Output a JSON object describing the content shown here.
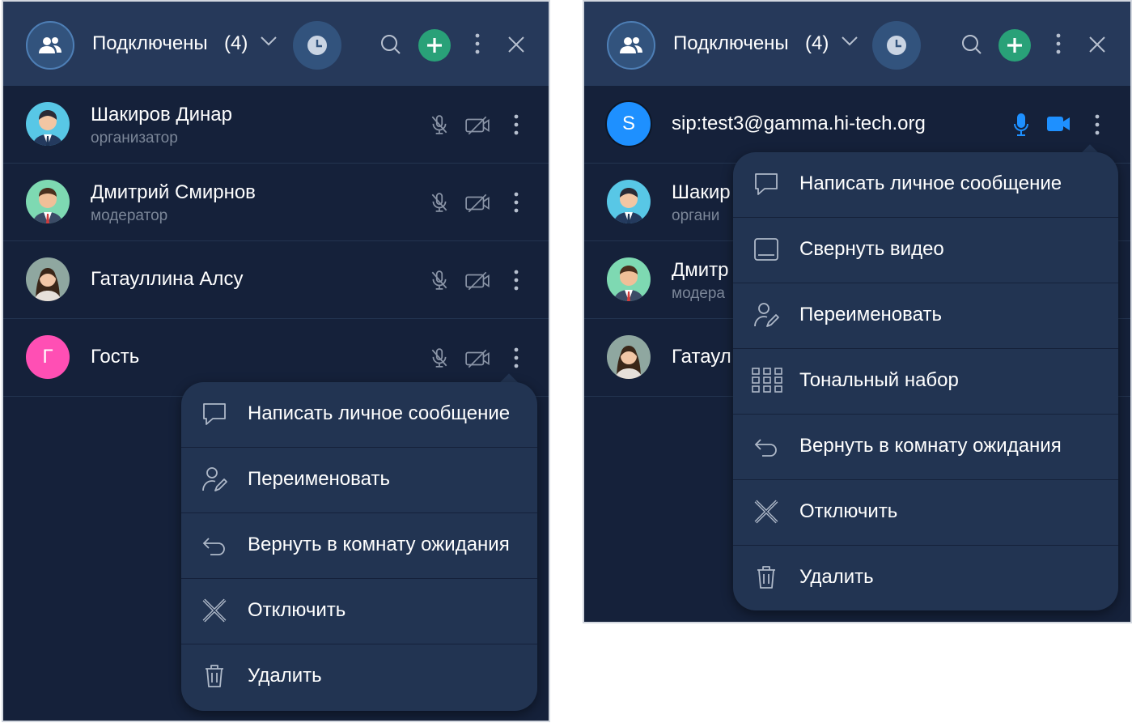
{
  "header": {
    "title": "Подключены",
    "count": "(4)"
  },
  "participants": [
    {
      "name": "Шакиров Динар",
      "role": "организатор"
    },
    {
      "name": "Дмитрий Смирнов",
      "role": "модератор"
    },
    {
      "name": "Гатауллина Алсу",
      "role": ""
    },
    {
      "name": "Гость",
      "role": "",
      "initial": "Г"
    }
  ],
  "sip_participant": {
    "name": "sip:test3@gamma.hi-tech.org",
    "initial": "S"
  },
  "right_panel_rows": [
    {
      "name_fragment": "Шакир",
      "role_fragment": "органи"
    },
    {
      "name_fragment": "Дмитр",
      "role_fragment": "модера"
    },
    {
      "name_fragment": "Гатаул"
    }
  ],
  "menu_left": [
    {
      "icon": "message-icon",
      "label": "Написать личное сообщение"
    },
    {
      "icon": "rename-icon",
      "label": "Переименовать"
    },
    {
      "icon": "return-icon",
      "label": "Вернуть в комнату ожидания"
    },
    {
      "icon": "disconnect-icon",
      "label": "Отключить"
    },
    {
      "icon": "trash-icon",
      "label": "Удалить"
    }
  ],
  "menu_right": [
    {
      "icon": "message-icon",
      "label": "Написать личное сообщение"
    },
    {
      "icon": "minimize-video-icon",
      "label": "Свернуть видео"
    },
    {
      "icon": "rename-icon",
      "label": "Переименовать"
    },
    {
      "icon": "dialpad-icon",
      "label": "Тональный набор"
    },
    {
      "icon": "return-icon",
      "label": "Вернуть в комнату ожидания"
    },
    {
      "icon": "disconnect-icon",
      "label": "Отключить"
    },
    {
      "icon": "trash-icon",
      "label": "Удалить"
    }
  ],
  "colors": {
    "background": "#15213a",
    "header": "#26395a",
    "menu": "#223452",
    "accent_green": "#29a178",
    "accent_blue": "#1e90ff",
    "guest_avatar": "#ff4fb4"
  }
}
